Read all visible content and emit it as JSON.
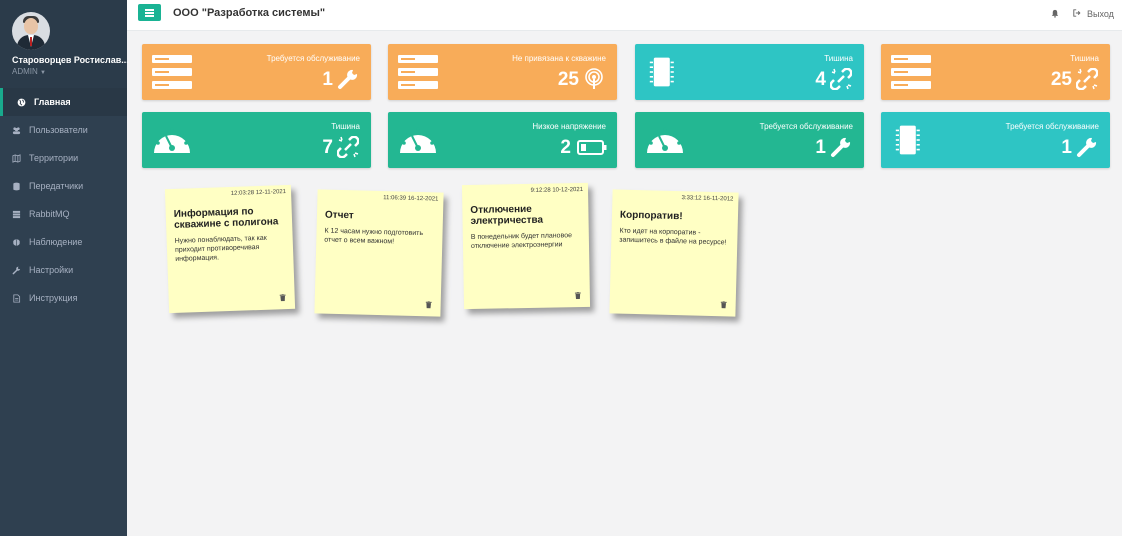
{
  "sidebar": {
    "user_name": "Староворцев Ростислав...",
    "user_role": "ADMIN",
    "items": [
      {
        "label": "Главная",
        "icon": "globe-icon",
        "active": true
      },
      {
        "label": "Пользователи",
        "icon": "users-icon"
      },
      {
        "label": "Территории",
        "icon": "map-icon"
      },
      {
        "label": "Передатчики",
        "icon": "database-icon"
      },
      {
        "label": "RabbitMQ",
        "icon": "server-icon"
      },
      {
        "label": "Наблюдение",
        "icon": "brain-icon"
      },
      {
        "label": "Настройки",
        "icon": "wrench-icon"
      },
      {
        "label": "Инструкция",
        "icon": "document-icon"
      }
    ]
  },
  "topbar": {
    "company": "ООО \"Разработка системы\"",
    "logout_label": "Выход"
  },
  "cards": [
    {
      "title": "Требуется обслуживание",
      "count": "1",
      "color": "#f8ac59",
      "big_icon": "server-icon",
      "small_icon": "wrench-icon"
    },
    {
      "title": "Не привязана к скважине",
      "count": "25",
      "color": "#f8ac59",
      "big_icon": "server-icon",
      "small_icon": "broadcast-icon"
    },
    {
      "title": "Тишина",
      "count": "4",
      "color": "#2ec5c4",
      "big_icon": "chip-icon",
      "small_icon": "broken-link-icon"
    },
    {
      "title": "Тишина",
      "count": "25",
      "color": "#f8ac59",
      "big_icon": "server-icon",
      "small_icon": "broken-link-icon"
    },
    {
      "title": "Тишина",
      "count": "7",
      "color": "#23b792",
      "big_icon": "gauge-icon",
      "small_icon": "broken-link-icon"
    },
    {
      "title": "Низкое напряжение",
      "count": "2",
      "color": "#23b792",
      "big_icon": "gauge-icon",
      "small_icon": "battery-low-icon"
    },
    {
      "title": "Требуется обслуживание",
      "count": "1",
      "color": "#23b792",
      "big_icon": "gauge-icon",
      "small_icon": "wrench-icon"
    },
    {
      "title": "Требуется обслуживание",
      "count": "1",
      "color": "#2ec5c4",
      "big_icon": "chip-icon",
      "small_icon": "wrench-icon"
    }
  ],
  "notes": [
    {
      "date": "12:03:28 12-11-2021",
      "title": "Информация по скважине с полигона",
      "text": "Нужно понаблюдать, так как приходит противоречивая информация."
    },
    {
      "date": "11:06:39 16-12-2021",
      "title": "Отчет",
      "text": "К 12 часам нужно подготовить отчет о всем важном!"
    },
    {
      "date": "9:12:28 10-12-2021",
      "title": "Отключение электричества",
      "text": "В понедельник будет плановое отключение электроэнергии"
    },
    {
      "date": "3:33:12 16-11-2012",
      "title": "Корпоратив!",
      "text": "Кто идет на корпоратив - запишитесь в файле на ресурсе!"
    }
  ]
}
